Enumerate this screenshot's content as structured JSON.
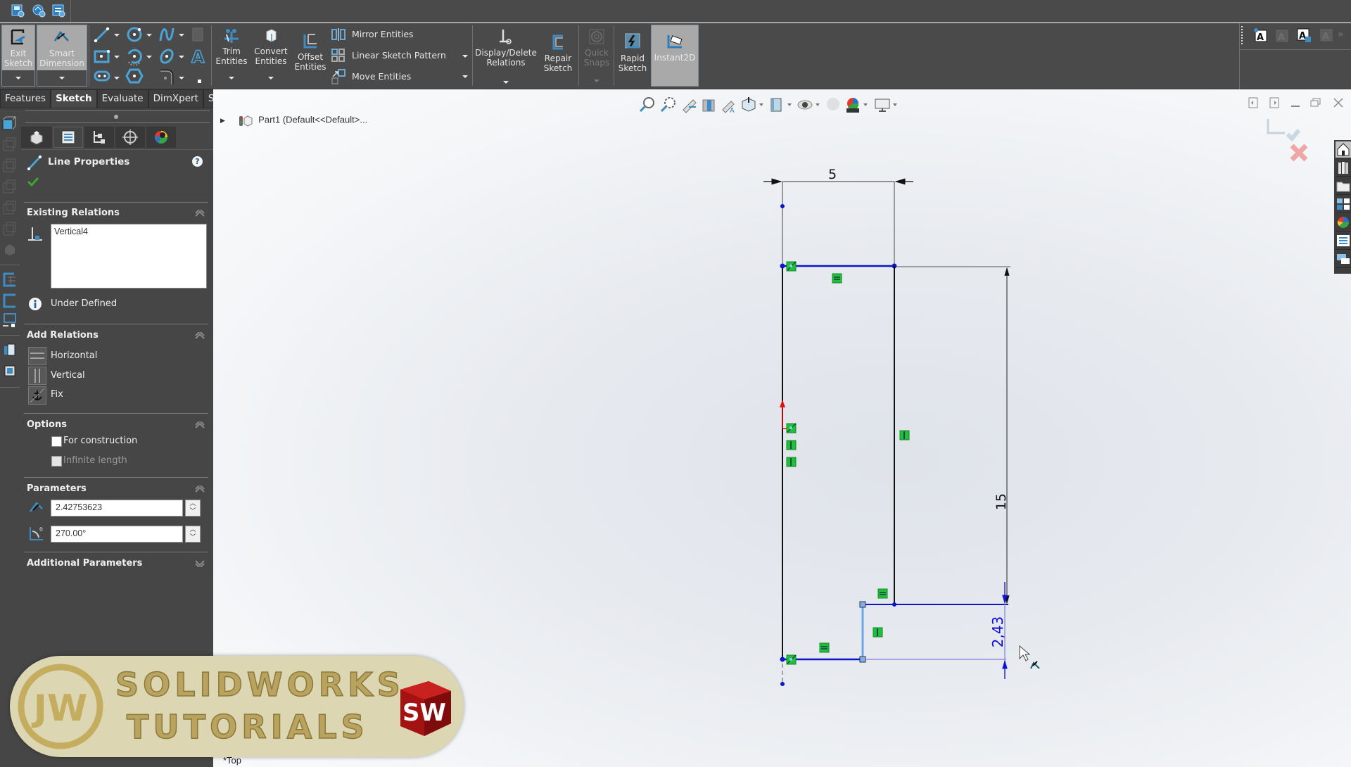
{
  "quick_access": {
    "icons": [
      "save-options-icon",
      "rebuild-options-icon",
      "file-properties-icon"
    ]
  },
  "ribbon": {
    "exit_sketch": {
      "line1": "Exit",
      "line2": "Sketch",
      "icon": "exit-sketch-icon"
    },
    "smart_dimension": {
      "line1": "Smart",
      "line2": "Dimension",
      "icon": "smart-dimension-icon"
    },
    "sketch_tools": [
      "line",
      "circle",
      "spline",
      "plane",
      "rectangle",
      "arc",
      "ellipse",
      "text",
      "slot",
      "polygon",
      "fillet",
      "point"
    ],
    "trim_entities": {
      "line1": "Trim",
      "line2": "Entities"
    },
    "convert_entities": {
      "line1": "Convert",
      "line2": "Entities"
    },
    "offset_entities": {
      "line1": "Offset",
      "line2": "Entities"
    },
    "mirror_entities": "Mirror Entities",
    "linear_sketch_pattern": "Linear Sketch Pattern",
    "move_entities": "Move Entities",
    "display_delete_relations": {
      "line1": "Display/Delete",
      "line2": "Relations"
    },
    "repair_sketch": {
      "line1": "Repair",
      "line2": "Sketch"
    },
    "quick_snaps": {
      "line1": "Quick",
      "line2": "Snaps"
    },
    "rapid_sketch": {
      "line1": "Rapid",
      "line2": "Sketch"
    },
    "instant2d": {
      "label": "Instant2D",
      "active": true
    }
  },
  "tabs": [
    {
      "label": "Features",
      "active": false
    },
    {
      "label": "Sketch",
      "active": true
    },
    {
      "label": "Evaluate",
      "active": false
    },
    {
      "label": "DimXpert",
      "active": false
    },
    {
      "label": "SOLIDWORKS Add-Ins",
      "active": false
    }
  ],
  "panel": {
    "title": "Line Properties",
    "help": "?",
    "existing_relations": {
      "title": "Existing Relations",
      "items": [
        "Vertical4"
      ],
      "status": "Under Defined"
    },
    "add_relations": {
      "title": "Add Relations",
      "items": [
        "Horizontal",
        "Vertical",
        "Fix"
      ]
    },
    "options": {
      "title": "Options",
      "for_construction": {
        "label": "For construction",
        "checked": false
      },
      "infinite_length": {
        "label": "Infinite length",
        "checked": false,
        "enabled": false
      }
    },
    "parameters": {
      "title": "Parameters",
      "length": "2.42753623",
      "angle": "270.00°"
    },
    "additional_parameters": {
      "title": "Additional Parameters"
    }
  },
  "viewport": {
    "tree_item": "Part1  (Default<<Default>...",
    "view_label": "*Top",
    "dimensions": {
      "width": "5",
      "height": "15",
      "active": "2,43"
    },
    "colors": {
      "sketch_blue": "#0a16c8",
      "selected_line": "#6ea6e8",
      "relation_green": "#22c03a",
      "dim_black": "#1a1a1a",
      "active_dim": "#1010d8"
    }
  },
  "watermark": {
    "line1": "SOLIDWORKS",
    "line2": "TUTORIALS",
    "logo": "JW",
    "badge": "SW"
  }
}
